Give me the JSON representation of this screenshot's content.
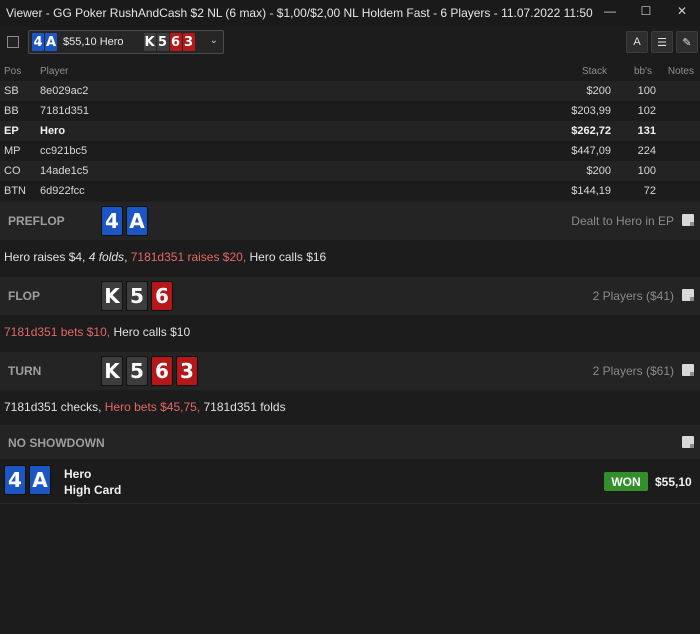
{
  "window": {
    "title": "Viewer - GG Poker RushAndCash $2 NL (6 max) - $1,00/$2,00 NL Holdem Fast - 6 Players - 11.07.2022 11:50",
    "minimize_glyph": "—",
    "maximize_glyph": "☐",
    "close_glyph": "✕"
  },
  "toolbar": {
    "hand_select": {
      "hole_cards": [
        {
          "rank": "4",
          "suit": "d"
        },
        {
          "rank": "A",
          "suit": "d"
        }
      ],
      "amount": "$55,10 Hero",
      "board": [
        {
          "rank": "K",
          "suit": "s"
        },
        {
          "rank": "5",
          "suit": "s"
        },
        {
          "rank": "6",
          "suit": "h"
        },
        {
          "rank": "3",
          "suit": "h"
        }
      ],
      "chevron": "⌄"
    },
    "icons": [
      {
        "name": "font-size-icon",
        "glyph": "A"
      },
      {
        "name": "list-icon",
        "glyph": "☰"
      },
      {
        "name": "edit-icon",
        "glyph": "✎"
      }
    ]
  },
  "table": {
    "headers": {
      "pos": "Pos",
      "player": "Player",
      "stack": "Stack",
      "bbs": "bb's",
      "notes": "Notes"
    },
    "rows": [
      {
        "pos": "SB",
        "player": "8e029ac2",
        "stack": "$200",
        "bbs": "100",
        "hero": false
      },
      {
        "pos": "BB",
        "player": "7181d351",
        "stack": "$203,99",
        "bbs": "102",
        "hero": false
      },
      {
        "pos": "EP",
        "player": "Hero",
        "stack": "$262,72",
        "bbs": "131",
        "hero": true
      },
      {
        "pos": "MP",
        "player": "cc921bc5",
        "stack": "$447,09",
        "bbs": "224",
        "hero": false
      },
      {
        "pos": "CO",
        "player": "14ade1c5",
        "stack": "$200",
        "bbs": "100",
        "hero": false
      },
      {
        "pos": "BTN",
        "player": "6d922fcc",
        "stack": "$144,19",
        "bbs": "72",
        "hero": false
      }
    ]
  },
  "streets": {
    "preflop": {
      "name": "PREFLOP",
      "info": "Dealt to Hero in EP",
      "cards": [
        {
          "rank": "4",
          "suit": "d"
        },
        {
          "rank": "A",
          "suit": "d"
        }
      ],
      "action": {
        "a": "Hero raises $4, ",
        "b": "4 folds",
        "c": ", ",
        "d": "7181d351 raises $20,",
        "e": " Hero calls $16"
      }
    },
    "flop": {
      "name": "FLOP",
      "info": "2 Players ($41)",
      "cards": [
        {
          "rank": "K",
          "suit": "s"
        },
        {
          "rank": "5",
          "suit": "s"
        },
        {
          "rank": "6",
          "suit": "h"
        }
      ],
      "action": {
        "a": "7181d351 bets $10,",
        "b": " Hero calls $10"
      }
    },
    "turn": {
      "name": "TURN",
      "info": "2 Players ($61)",
      "cards": [
        {
          "rank": "K",
          "suit": "s"
        },
        {
          "rank": "5",
          "suit": "s"
        },
        {
          "rank": "6",
          "suit": "h"
        },
        {
          "rank": "3",
          "suit": "h"
        }
      ],
      "action": {
        "a": "7181d351 checks, ",
        "b": "Hero bets $45,75,",
        "c": " 7181d351 folds"
      }
    },
    "showdown": {
      "name": "NO SHOWDOWN"
    }
  },
  "result": {
    "cards": [
      {
        "rank": "4",
        "suit": "d"
      },
      {
        "rank": "A",
        "suit": "d"
      }
    ],
    "player": "Hero",
    "hand_rank": "High Card",
    "badge": "WON",
    "amount": "$55,10"
  },
  "colors": {
    "spade": "#3d3d3d",
    "heart": "#b51818",
    "diamond": "#1c56c4",
    "won": "#338f2a",
    "action_red": "#e46767"
  }
}
